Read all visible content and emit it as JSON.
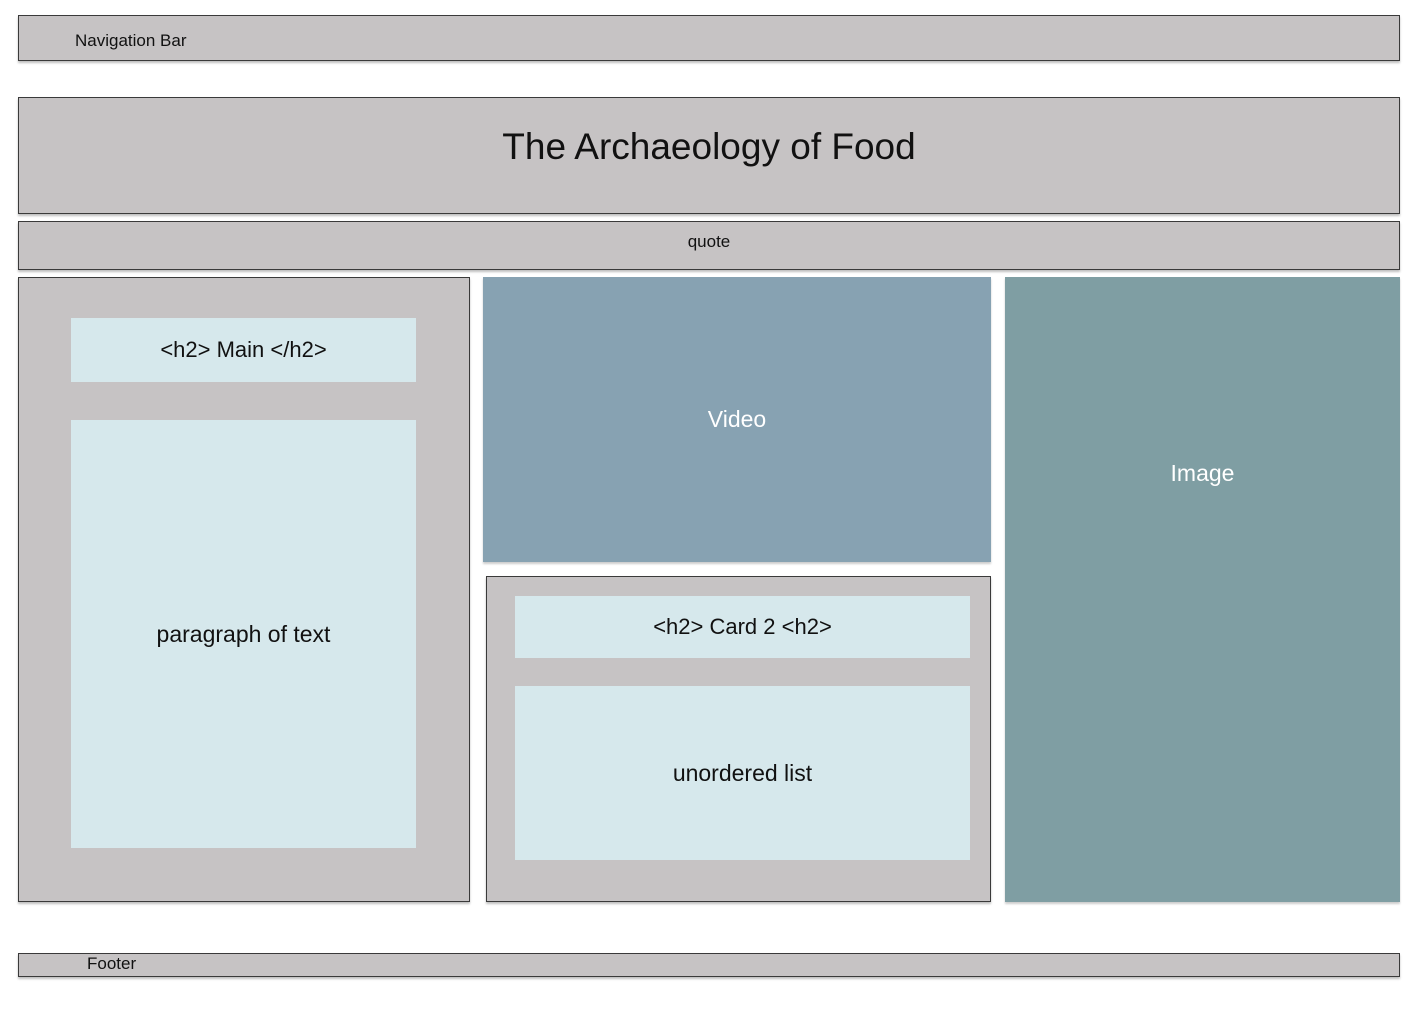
{
  "nav": {
    "label": "Navigation Bar"
  },
  "header": {
    "title": "The Archaeology of Food"
  },
  "quote": {
    "label": "quote"
  },
  "main": {
    "heading": "<h2> Main </h2>",
    "paragraph": "paragraph of text"
  },
  "video": {
    "label": "Video"
  },
  "card2": {
    "heading": "<h2> Card 2 <h2>",
    "list": "unordered list"
  },
  "image": {
    "label": "Image"
  },
  "footer": {
    "label": "Footer"
  },
  "colors": {
    "block_grey": "#c6c3c4",
    "content_light": "#d6e8ec",
    "video_blue": "#87a2b2",
    "image_teal": "#7f9ea3"
  }
}
